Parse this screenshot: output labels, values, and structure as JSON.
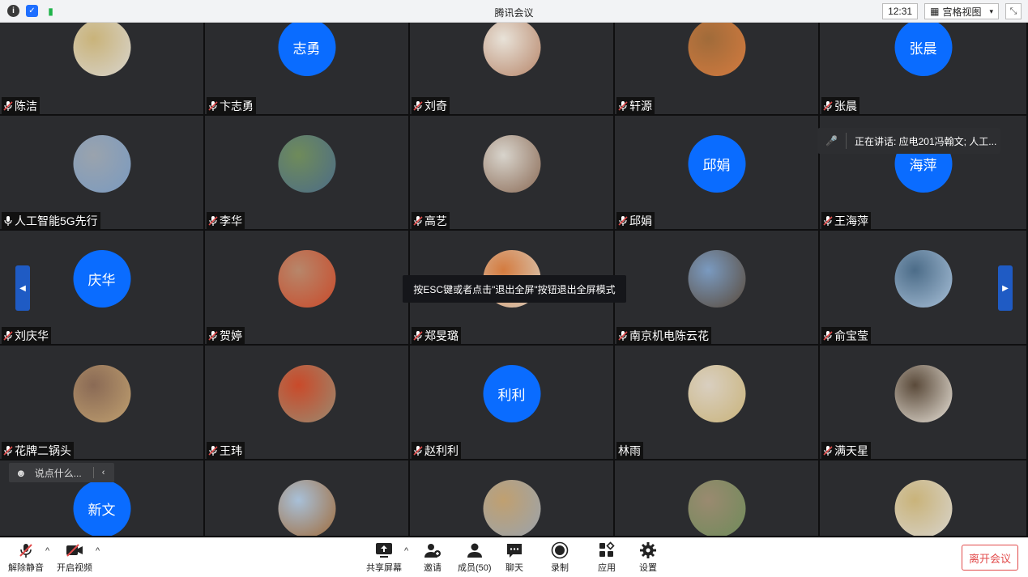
{
  "app": {
    "title": "腾讯会议",
    "clock": "12:31",
    "view_label": "宫格视图"
  },
  "participants": [
    {
      "name": "陈洁",
      "muted": true,
      "avatar": "photo"
    },
    {
      "name": "卞志勇",
      "muted": true,
      "avatar_text": "志勇"
    },
    {
      "name": "刘奇",
      "muted": true,
      "avatar": "photo"
    },
    {
      "name": "轩源",
      "muted": true,
      "avatar": "photo"
    },
    {
      "name": "张晨",
      "muted": true,
      "avatar_text": "张晨"
    },
    {
      "name": "人工智能5G先行",
      "muted": false,
      "avatar": "photo"
    },
    {
      "name": "李华",
      "muted": true,
      "avatar": "photo"
    },
    {
      "name": "高艺",
      "muted": true,
      "avatar": "photo"
    },
    {
      "name": "邱娟",
      "muted": true,
      "avatar_text": "邱娟"
    },
    {
      "name": "王海萍",
      "muted": true,
      "avatar_text": "海萍"
    },
    {
      "name": "刘庆华",
      "muted": true,
      "avatar_text": "庆华"
    },
    {
      "name": "贺婷",
      "muted": true,
      "avatar": "photo"
    },
    {
      "name": "郑旻璐",
      "muted": true,
      "avatar": "photo"
    },
    {
      "name": "南京机电陈云花",
      "muted": true,
      "avatar": "photo"
    },
    {
      "name": "俞宝莹",
      "muted": true,
      "avatar": "photo"
    },
    {
      "name": "花牌二锅头",
      "muted": true,
      "avatar": "photo"
    },
    {
      "name": "王玮",
      "muted": true,
      "avatar": "photo"
    },
    {
      "name": "赵利利",
      "muted": true,
      "avatar_text": "利利"
    },
    {
      "name": "林雨",
      "muted": null,
      "avatar": "photo"
    },
    {
      "name": "满天星",
      "muted": true,
      "avatar": "photo"
    },
    {
      "name": "",
      "muted": null,
      "avatar_text": "新文"
    },
    {
      "name": "",
      "muted": null,
      "avatar": "photo"
    },
    {
      "name": "",
      "muted": null,
      "avatar": "photo"
    },
    {
      "name": "",
      "muted": null,
      "avatar": "photo"
    },
    {
      "name": "",
      "muted": null,
      "avatar": "photo"
    }
  ],
  "overlays": {
    "toast": "按ESC键或者点击\"退出全屏\"按钮退出全屏模式",
    "speaking": "正在讲话: 应电201冯翰文; 人工...",
    "chat_placeholder": "说点什么..."
  },
  "toolbar": {
    "unmute": "解除静音",
    "start_video": "开启视频",
    "share": "共享屏幕",
    "invite": "邀请",
    "members": "成员(50)",
    "chat": "聊天",
    "record": "录制",
    "apps": "应用",
    "settings": "设置",
    "leave": "离开会议"
  },
  "colors": {
    "accent": "#0a6cff",
    "leave": "#e24b4b",
    "tile_bg": "#2b2c2f"
  }
}
